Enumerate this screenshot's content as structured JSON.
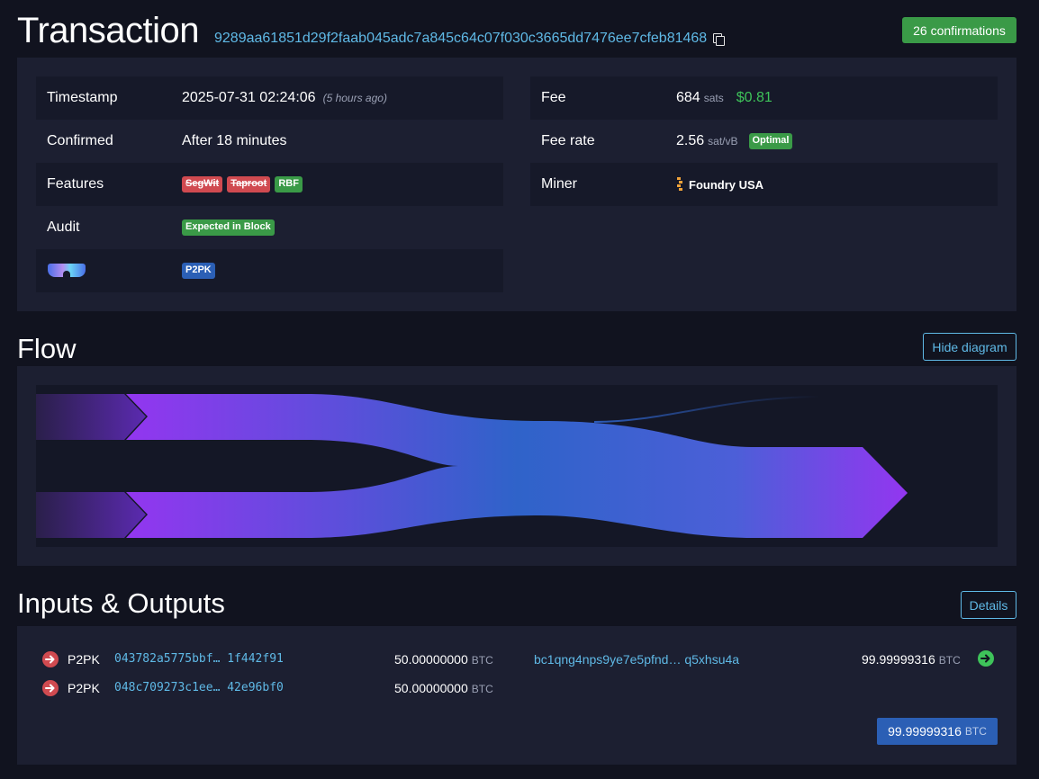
{
  "header": {
    "title": "Transaction",
    "txid": "9289aa61851d29f2faab045adc7a845c64c07f030c3665dd7476ee7cfeb81468",
    "confirmations": "26 confirmations"
  },
  "details": {
    "left": [
      {
        "key": "Timestamp",
        "value": "2025-07-31 02:24:06",
        "note": "(5 hours ago)"
      },
      {
        "key": "Confirmed",
        "value": "After 18 minutes"
      },
      {
        "key": "Features",
        "tags": [
          "SegWit",
          "Taproot",
          "RBF"
        ]
      },
      {
        "key": "Audit",
        "tag": "Expected in Block"
      },
      {
        "key_icon": "glasses-icon",
        "tag": "P2PK"
      }
    ],
    "right": [
      {
        "key": "Fee",
        "value": "684",
        "unit": "sats",
        "usd": "$0.81"
      },
      {
        "key": "Fee rate",
        "value": "2.56",
        "unit": "sat/vB",
        "tag": "Optimal"
      },
      {
        "key": "Miner",
        "value": "Foundry USA",
        "icon": "foundry-logo-icon"
      }
    ]
  },
  "flow": {
    "title": "Flow",
    "hide_button": "Hide diagram"
  },
  "io": {
    "title": "Inputs & Outputs",
    "details_button": "Details",
    "inputs": [
      {
        "type": "P2PK",
        "addr_start": "043782a5775bbf…",
        "addr_end": "1f442f91",
        "amount": "50.00000000",
        "unit": "BTC"
      },
      {
        "type": "P2PK",
        "addr_start": "048c709273c1ee…",
        "addr_end": "42e96bf0",
        "amount": "50.00000000",
        "unit": "BTC"
      }
    ],
    "outputs": [
      {
        "addr_start": "bc1qng4nps9ye7e5pfnd…",
        "addr_end": "q5xhsu4a",
        "amount": "99.99999316",
        "unit": "BTC"
      }
    ],
    "total": {
      "amount": "99.99999316",
      "unit": "BTC"
    }
  },
  "colors": {
    "accent": "#5fb9e6",
    "success": "#3a9a47",
    "danger": "#d04a50",
    "info": "#2b5fb5",
    "flow_purple": "#9336f0",
    "flow_blue": "#2f63c9"
  }
}
